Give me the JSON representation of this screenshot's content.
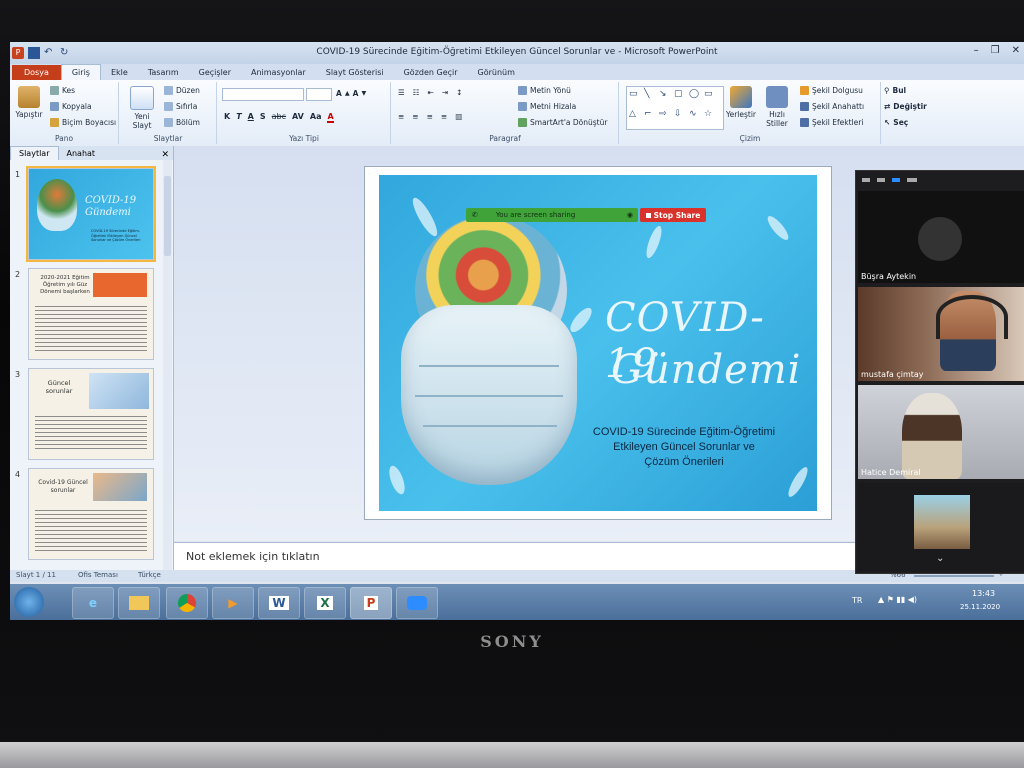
{
  "window": {
    "title": "COVID-19 Sürecinde Eğitim-Öğretimi Etkileyen Güncel Sorunlar ve  -  Microsoft PowerPoint",
    "app_icon": "P"
  },
  "tabs": [
    "Dosya",
    "Giriş",
    "Ekle",
    "Tasarım",
    "Geçişler",
    "Animasyonlar",
    "Slayt Gösterisi",
    "Gözden Geçir",
    "Görünüm"
  ],
  "ribbon": {
    "pano": {
      "label": "Pano",
      "paste": "Yapıştır",
      "cut": "Kes",
      "copy": "Kopyala",
      "format_painter": "Biçim Boyacısı"
    },
    "slaytlar": {
      "label": "Slaytlar",
      "new_slide": "Yeni Slayt",
      "layout": "Düzen",
      "reset": "Sıfırla",
      "section": "Bölüm"
    },
    "yazi_tipi": {
      "label": "Yazı Tipi",
      "bold": "K",
      "italic": "T",
      "underline": "A",
      "strike": "abc",
      "spacing": "AV",
      "case": "Aa"
    },
    "paragraf": {
      "label": "Paragraf",
      "text_direction": "Metin Yönü",
      "align_text": "Metni Hizala",
      "smartart": "SmartArt'a Dönüştür"
    },
    "cizim": {
      "label": "Çizim",
      "arrange": "Yerleştir",
      "quick_styles": "Hızlı Stiller",
      "fill": "Şekil Dolgusu",
      "outline": "Şekil Anahattı",
      "effects": "Şekil Efektleri"
    },
    "duzenleme": {
      "find": "Bul",
      "replace": "Değiştir",
      "select": "Seç"
    }
  },
  "left_panel": {
    "tabs": [
      "Slaytlar",
      "Anahat"
    ],
    "thumbnails": [
      {
        "num": "1",
        "title": "COVID-19 Gündemi",
        "sub": "COVID-19 Sürecinde Eğitim-Öğretimi Etkileyen Güncel Sorunlar ve Çözüm Önerileri"
      },
      {
        "num": "2",
        "title": "2020-2021 Eğitim Öğretim yılı Güz Dönemi başlarken"
      },
      {
        "num": "3",
        "title": "Güncel sorunlar"
      },
      {
        "num": "4",
        "title": "Covid-19 Güncel sorunlar"
      }
    ]
  },
  "slide": {
    "title_line1": "COVID-19",
    "title_line2": "Gündemi",
    "subtitle_line1": "COVID-19 Sürecinde Eğitim-Öğretimi",
    "subtitle_line2": "Etkileyen Güncel Sorunlar ve",
    "subtitle_line3": "Çözüm Önerileri"
  },
  "screen_share": {
    "status": "You are screen sharing",
    "stop": "Stop Share"
  },
  "notes_placeholder": "Not eklemek için tıklatın",
  "statusbar": {
    "slide_count": "Slayt 1 / 11",
    "theme": "Ofis Teması",
    "language": "Türkçe",
    "zoom": "%66"
  },
  "participants": [
    {
      "name": "Büşra Aytekin"
    },
    {
      "name": "mustafa çimtay"
    },
    {
      "name": "Hatice Demiral"
    }
  ],
  "taskbar": {
    "lang": "TR",
    "time": "13:43",
    "date": "25.11.2020",
    "apps": [
      "W",
      "X",
      "P"
    ]
  },
  "hardware": {
    "brand": "SONY"
  }
}
